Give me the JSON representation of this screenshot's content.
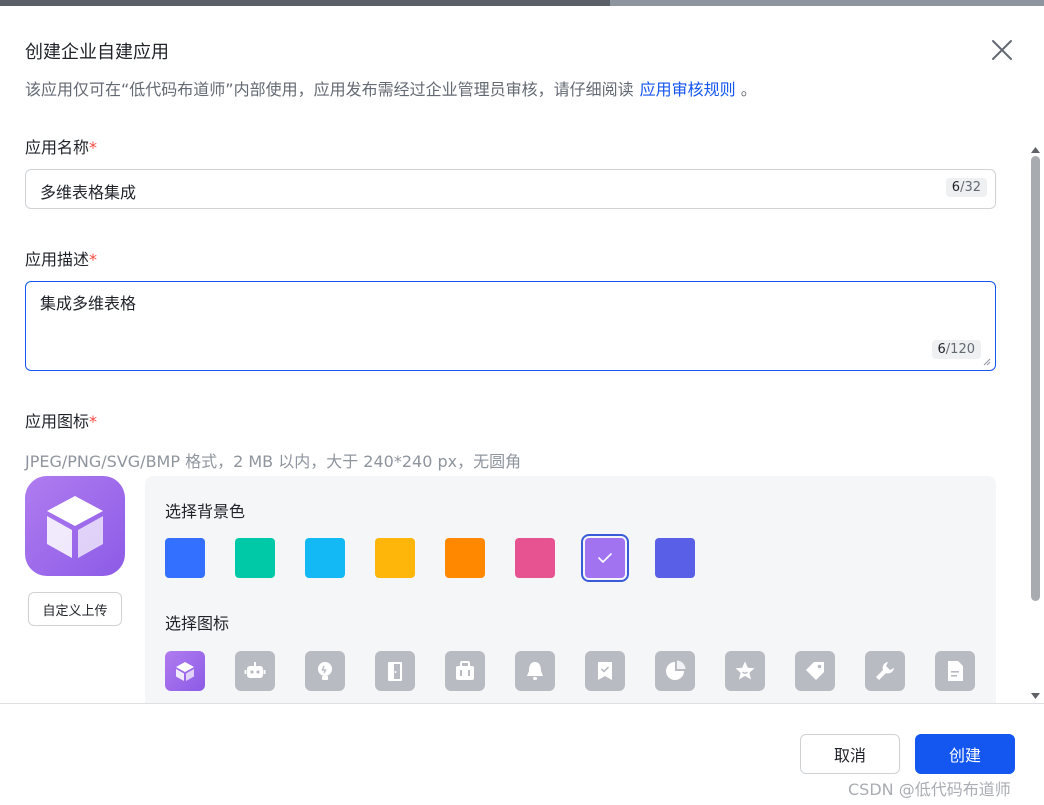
{
  "dialog": {
    "title": "创建企业自建应用",
    "subtitle": "该应用仅可在“低代码布道师”内部使用，应用发布需经过企业管理员审核，请仔细阅读",
    "rules_link": "应用审核规则",
    "subtitle_end": "。"
  },
  "form": {
    "name": {
      "label": "应用名称",
      "required_mark": "*",
      "value": "多维表格集成",
      "count_current": "6",
      "count_max": "/32"
    },
    "description": {
      "label": "应用描述",
      "required_mark": "*",
      "value": "集成多维表格",
      "count_current": "6",
      "count_max": "/120"
    },
    "icon": {
      "label": "应用图标",
      "required_mark": "*",
      "hint": "JPEG/PNG/SVG/BMP 格式，2 MB 以内，大于 240*240 px，无圆角",
      "upload_label": "自定义上传",
      "bg_label": "选择背景色",
      "icon_label": "选择图标",
      "colors": [
        "#3370ff",
        "#00c9a7",
        "#12b9f5",
        "#ffb60a",
        "#ff8800",
        "#e75391",
        "#a173f0",
        "#5a5fe8"
      ],
      "selected_color_index": 6,
      "icons": [
        "cube-icon",
        "robot-icon",
        "lightbulb-icon",
        "door-icon",
        "briefcase-icon",
        "bell-icon",
        "bookmark-check-icon",
        "pie-chart-icon",
        "star-icon",
        "tag-icon",
        "wrench-icon",
        "document-icon"
      ],
      "selected_icon_index": 0
    }
  },
  "footer": {
    "cancel_label": "取消",
    "create_label": "创建",
    "watermark": "CSDN @低代码布道师"
  }
}
